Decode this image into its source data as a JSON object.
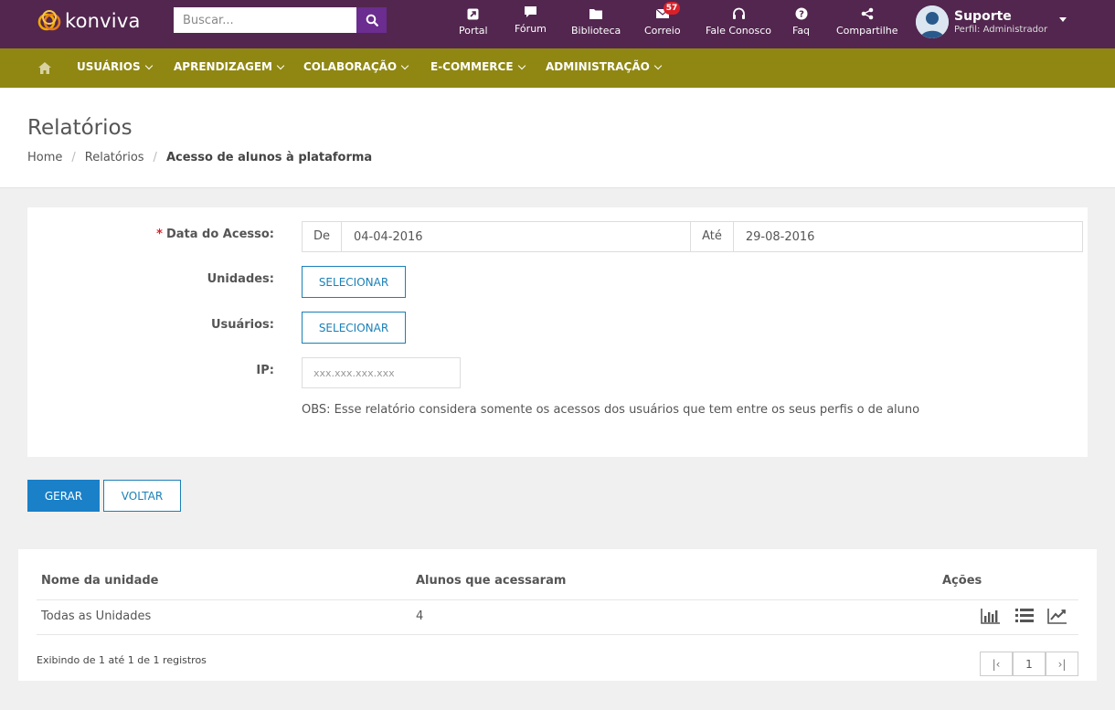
{
  "brand": {
    "name": "konviva"
  },
  "search": {
    "placeholder": "Buscar..."
  },
  "top_nav": [
    {
      "label": "Portal",
      "icon": "external-link-icon"
    },
    {
      "label": "Fórum",
      "icon": "comment-icon"
    },
    {
      "label": "Biblioteca",
      "icon": "folder-icon"
    },
    {
      "label": "Correio",
      "icon": "envelope-icon",
      "badge": "57"
    },
    {
      "label": "Fale Conosco",
      "icon": "headset-icon"
    },
    {
      "label": "Faq",
      "icon": "question-circle-icon"
    },
    {
      "label": "Compartilhe",
      "icon": "share-icon"
    }
  ],
  "user": {
    "name": "Suporte",
    "role": "Perfil: Administrador"
  },
  "menu": [
    {
      "label": "USUÁRIOS"
    },
    {
      "label": "APRENDIZAGEM"
    },
    {
      "label": "COLABORAÇÃO"
    },
    {
      "label": "E-COMMERCE"
    },
    {
      "label": "ADMINISTRAÇÃO"
    }
  ],
  "page": {
    "title": "Relatórios",
    "breadcrumb": [
      "Home",
      "Relatórios",
      "Acesso de alunos à plataforma"
    ]
  },
  "form": {
    "date_label": "Data do Acesso:",
    "required_mark": "*",
    "from_label": "De",
    "from_value": "04-04-2016",
    "to_label": "Até",
    "to_value": "29-08-2016",
    "units_label": "Unidades:",
    "units_button": "SELECIONAR",
    "users_label": "Usuários:",
    "users_button": "SELECIONAR",
    "ip_label": "IP:",
    "ip_placeholder": "xxx.xxx.xxx.xxx",
    "obs": "OBS: Esse relatório considera somente os acessos dos usuários que tem entre os seus perfis o de aluno"
  },
  "actions": {
    "generate": "GERAR",
    "back": "VOLTAR"
  },
  "table": {
    "headers": [
      "Nome da unidade",
      "Alunos que acessaram",
      "Ações"
    ],
    "rows": [
      {
        "unit": "Todas as Unidades",
        "count": "4"
      }
    ],
    "info": "Exibindo de 1 até 1 de 1 registros",
    "pagination": {
      "first": "|‹",
      "page": "1",
      "last": "›|"
    }
  },
  "colors": {
    "topbar": "#52264f",
    "menubar": "#8f8712",
    "search_button": "#6b2d8f",
    "primary": "#1a80c8",
    "badge": "#d9202a"
  }
}
